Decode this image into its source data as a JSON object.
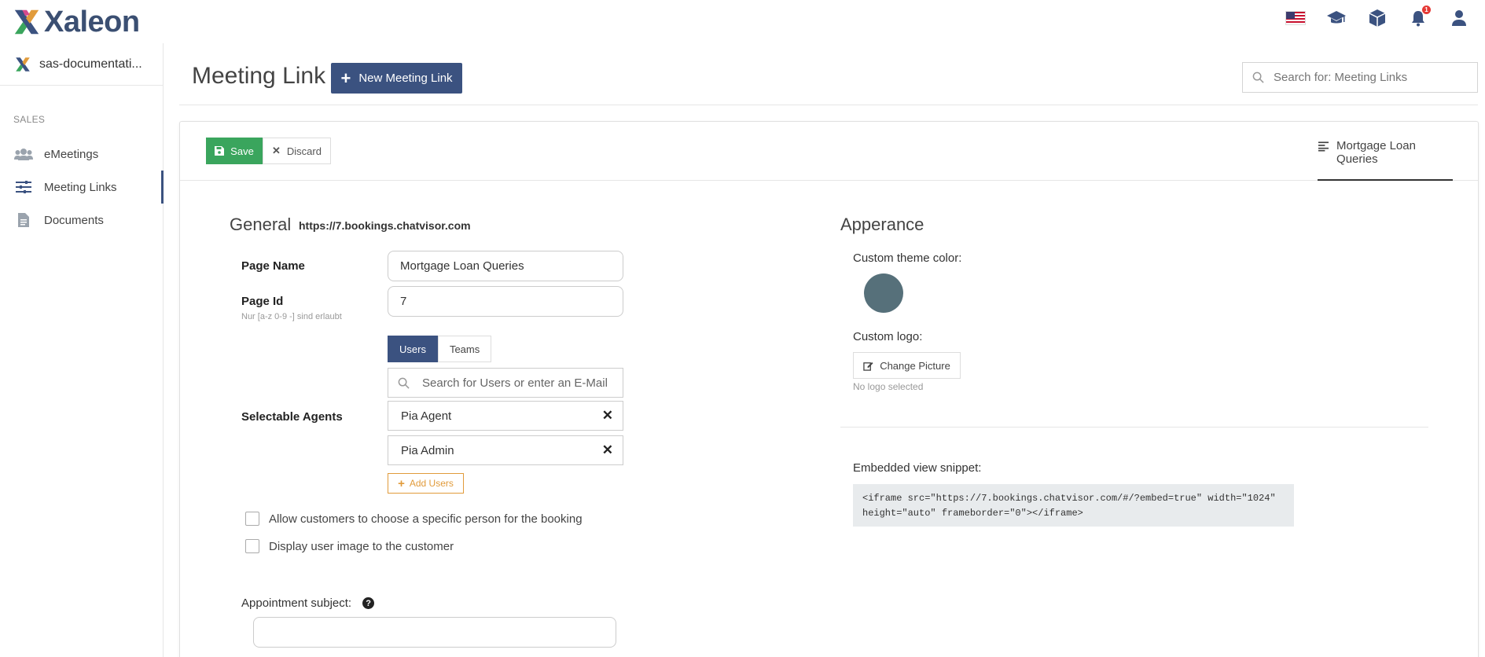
{
  "brand": {
    "name": "Xaleon",
    "colors": {
      "primary": "#3b5280",
      "success": "#3aa55d",
      "warning": "#e19b3b",
      "theme": "#56707a"
    }
  },
  "top_icons": [
    "us-flag-icon",
    "graduation-cap-icon",
    "cube-icon",
    "bell-icon",
    "user-icon"
  ],
  "notifications_badge": "1",
  "sidebar": {
    "org_name": "sas-documentati...",
    "section": "SALES",
    "items": [
      {
        "label": "eMeetings",
        "icon": "users-icon"
      },
      {
        "label": "Meeting Links",
        "icon": "sliders-icon"
      },
      {
        "label": "Documents",
        "icon": "document-icon"
      }
    ]
  },
  "header": {
    "title": "Meeting Link",
    "new_button": "New Meeting Link",
    "search_placeholder": "Search for: Meeting Links"
  },
  "toolbar": {
    "save_label": "Save",
    "discard_label": "Discard",
    "tab_label": "Mortgage Loan Queries"
  },
  "general": {
    "title": "General",
    "url": "https://7.bookings.chatvisor.com",
    "page_name_label": "Page Name",
    "page_name_value": "Mortgage Loan Queries",
    "page_id_label": "Page Id",
    "page_id_hint": "Nur [a-z 0-9 -] sind erlaubt",
    "page_id_value": "7",
    "agents_label": "Selectable Agents",
    "tab_users": "Users",
    "tab_teams": "Teams",
    "agent_search_placeholder": "Search for Users or enter an E-Mail",
    "agents": [
      "Pia Agent",
      "Pia Admin"
    ],
    "add_users_label": "Add Users",
    "option_choose_person": "Allow customers to choose a specific person for the booking",
    "option_display_image": "Display user image to the customer",
    "subject_label": "Appointment subject:",
    "subject_value": ""
  },
  "appearance": {
    "title": "Apperance",
    "theme_color_label": "Custom theme color:",
    "logo_label": "Custom logo:",
    "change_picture_label": "Change Picture",
    "no_logo_text": "No logo selected",
    "snippet_label": "Embedded view snippet:",
    "snippet_code": "<iframe src=\"https://7.bookings.chatvisor.com/#/?embed=true\" width=\"1024\"\nheight=\"auto\" frameborder=\"0\"></iframe>"
  }
}
